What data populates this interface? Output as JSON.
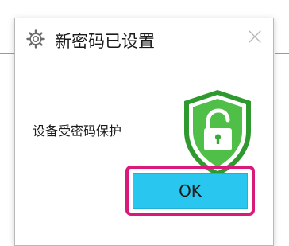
{
  "dialog": {
    "title": "新密码已设置",
    "title_icon": "gear-icon",
    "close_icon": "close-icon",
    "message": "设备受密码保护",
    "status_icon": "shield-unlocked-icon",
    "ok_label": "OK"
  },
  "colors": {
    "ok_button": "#29c6f0",
    "highlight_border": "#d81b7a",
    "shield_green": "#4fbf48",
    "shield_dark_green": "#2e9a2e"
  }
}
